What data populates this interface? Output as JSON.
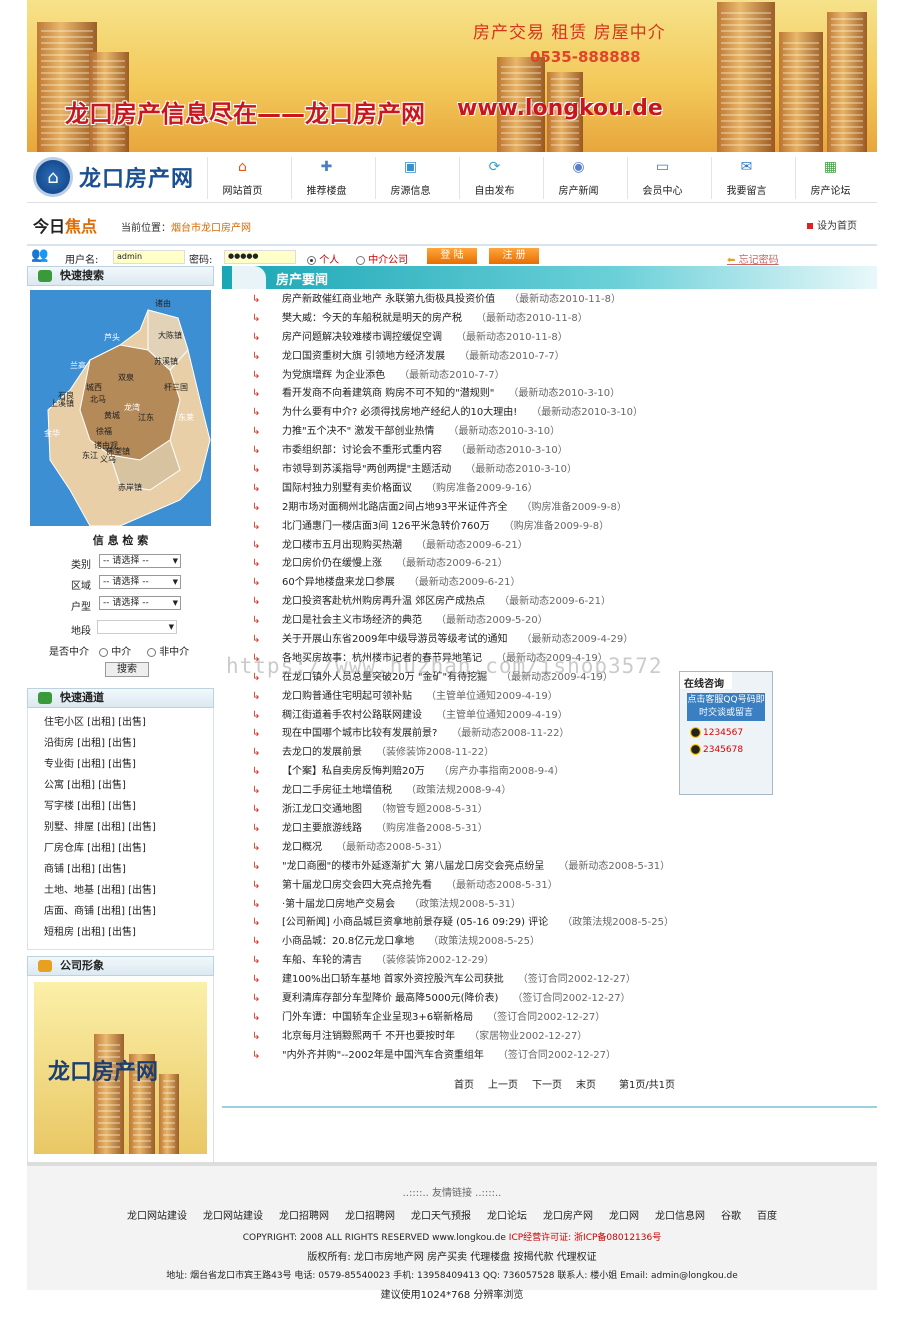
{
  "banner": {
    "tagline": "房产交易 租赁 房屋中介",
    "phone": "0535-888888",
    "slogan": "龙口房产信息尽在——龙口房产网",
    "url": "www.longkou.de"
  },
  "logo": {
    "text": "龙口房产网"
  },
  "nav": [
    {
      "label": "网站首页",
      "icon": "home-icon",
      "color": "#e8571f"
    },
    {
      "label": "推荐楼盘",
      "icon": "gamepad-icon",
      "color": "#4c7fc0"
    },
    {
      "label": "房源信息",
      "icon": "folder-icon",
      "color": "#3a8fd0"
    },
    {
      "label": "自由发布",
      "icon": "refresh-icon",
      "color": "#3aa0c8"
    },
    {
      "label": "房产新闻",
      "icon": "disc-icon",
      "color": "#5a7fc9"
    },
    {
      "label": "会员中心",
      "icon": "monitor-icon",
      "color": "#3a7fc0"
    },
    {
      "label": "我要留言",
      "icon": "chat-icon",
      "color": "#2b77c4"
    },
    {
      "label": "房产论坛",
      "icon": "picture-icon",
      "color": "#4aa04a"
    }
  ],
  "bar": {
    "today": "今日",
    "focus": "焦点",
    "location_label": "当前位置：",
    "location": "烟台市龙口房产网",
    "set_home": "设为首页"
  },
  "login": {
    "user_label": "用户名:",
    "user_value": "admin",
    "pass_label": "密码:",
    "pass_value": "●●●●●",
    "personal": "个人",
    "agency": "中介公司",
    "login_btn": "登 陆",
    "register_btn": "注 册",
    "forgot": "忘记密码"
  },
  "left": {
    "quick_search": "快速搜索",
    "map_regions": [
      "诸由",
      "大陈镇",
      "芦头",
      "苏溪镇",
      "兰高",
      "石良",
      "双泉",
      "城西",
      "杆三国",
      "上溪镇",
      "北马",
      "黄城",
      "龙湾",
      "江东",
      "东莱",
      "徐福",
      "金华",
      "诸由观",
      "东江",
      "佛堂镇",
      "赤岸镇",
      "义乌"
    ],
    "info_search": "信 息 检 索",
    "fields": [
      {
        "label": "类别",
        "value": "-- 请选择 --"
      },
      {
        "label": "区域",
        "value": "-- 请选择 --"
      },
      {
        "label": "户型",
        "value": "-- 请选择 --"
      }
    ],
    "address_label": "地段",
    "agency_label": "是否中介",
    "agency_yes": "中介",
    "agency_no": "非中介",
    "search_btn": "搜索",
    "fast_channel": "快速通道",
    "channels": [
      "住宅小区 [出租] [出售]",
      "沿街房 [出租] [出售]",
      "专业街 [出租] [出售]",
      "公寓 [出租] [出售]",
      "写字楼 [出租] [出售]",
      "别墅、排屋 [出租] [出售]",
      "厂房仓库 [出租] [出售]",
      "商铺 [出租] [出售]",
      "土地、地基 [出租] [出售]",
      "店面、商铺 [出租] [出售]",
      "短租房 [出租] [出售]"
    ],
    "company_image": "公司形象",
    "company_logo_text": "龙口房产网"
  },
  "right": {
    "title": "房产要闻",
    "news": [
      {
        "t": "房产新政催红商业地产 永联第九街极具投资价值",
        "d": "（最新动态2010-11-8）"
      },
      {
        "t": "樊大威：今天的车船税就是明天的房产税",
        "d": "（最新动态2010-11-8）"
      },
      {
        "t": "房产问题解决较难楼市调控缓促空调",
        "d": "（最新动态2010-11-8）"
      },
      {
        "t": "龙口国资重树大旗 引领地方经济发展",
        "d": "（最新动态2010-7-7）"
      },
      {
        "t": "为党旗增辉 为企业添色",
        "d": "（最新动态2010-7-7）"
      },
      {
        "t": "看开发商不向着建筑商 购房不可不知的\"潜规则\"",
        "d": "（最新动态2010-3-10）"
      },
      {
        "t": "为什么要有中介? 必须得找房地产经纪人的10大理由!",
        "d": "（最新动态2010-3-10）"
      },
      {
        "t": "力推\"五个决不\" 激发干部创业热情",
        "d": "（最新动态2010-3-10）"
      },
      {
        "t": "市委组织部：讨论会不重形式重内容",
        "d": "（最新动态2010-3-10）"
      },
      {
        "t": "市领导到苏溪指导\"两创两提\"主题活动",
        "d": "（最新动态2010-3-10）"
      },
      {
        "t": "国际村独力别墅有卖价格面议",
        "d": "（购房准备2009-9-16）"
      },
      {
        "t": "2期市场对面稠州北路店面2间占地93平米证件齐全",
        "d": "（购房准备2009-9-8）"
      },
      {
        "t": "北门通惠门一楼店面3间 126平米急转价760万",
        "d": "（购房准备2009-9-8）"
      },
      {
        "t": "龙口楼市五月出现购买热潮",
        "d": "（最新动态2009-6-21）"
      },
      {
        "t": "龙口房价仍在缓慢上涨",
        "d": "（最新动态2009-6-21）"
      },
      {
        "t": "60个异地楼盘来龙口参展",
        "d": "（最新动态2009-6-21）"
      },
      {
        "t": "龙口投资客赴杭州购房再升温 郊区房产成热点",
        "d": "（最新动态2009-6-21）"
      },
      {
        "t": "龙口是社会主义市场经济的典范",
        "d": "（最新动态2009-5-20）"
      },
      {
        "t": "关于开展山东省2009年中级导游员等级考试的通知",
        "d": "（最新动态2009-4-29）"
      },
      {
        "t": "各地买房故事：杭州楼市记者的春节异地笔记",
        "d": "（最新动态2009-4-19）"
      },
      {
        "t": "在龙口镇外人员总量突破20万 \"金矿\"有待挖掘",
        "d": "（最新动态2009-4-19）"
      },
      {
        "t": "龙口购普通住宅明起可领补贴",
        "d": "（主管单位通知2009-4-19）"
      },
      {
        "t": "稠江街道着手农村公路联网建设",
        "d": "（主管单位通知2009-4-19）"
      },
      {
        "t": "现在中国哪个城市比较有发展前景?",
        "d": "（最新动态2008-11-22）"
      },
      {
        "t": "去龙口的发展前景",
        "d": "（装修装饰2008-11-22）"
      },
      {
        "t": "【个案】私自卖房反悔判赔20万",
        "d": "（房产办事指南2008-9-4）"
      },
      {
        "t": "龙口二手房征土地增值税",
        "d": "（政策法规2008-9-4）"
      },
      {
        "t": "浙江龙口交通地图",
        "d": "（物管专题2008-5-31）"
      },
      {
        "t": "龙口主要旅游线路",
        "d": "（购房准备2008-5-31）"
      },
      {
        "t": "龙口概况",
        "d": "（最新动态2008-5-31）"
      },
      {
        "t": "\"龙口商圈\"的楼市外延逐渐扩大 第八届龙口房交会亮点纷呈",
        "d": "（最新动态2008-5-31）"
      },
      {
        "t": "第十届龙口房交会四大亮点抢先看",
        "d": "（最新动态2008-5-31）"
      },
      {
        "t": "·第十届龙口房地产交易会",
        "d": "（政策法规2008-5-31）"
      },
      {
        "t": "[公司新闻] 小商品城巨资拿地前景存疑 (05-16 09:29) 评论",
        "d": "（政策法规2008-5-25）"
      },
      {
        "t": "小商品城：20.8亿元龙口拿地",
        "d": "（政策法规2008-5-25）"
      },
      {
        "t": "车船、车轮的清吉",
        "d": "（装修装饰2002-12-29）"
      },
      {
        "t": "建100%出口轿车基地 首家外资控股汽车公司获批",
        "d": "（签订合同2002-12-27）"
      },
      {
        "t": "夏利清库存部分车型降价 最高降5000元(降价表)",
        "d": "（签订合同2002-12-27）"
      },
      {
        "t": "门外车谭：中国轿车企业呈现3+6崭新格局",
        "d": "（签订合同2002-12-27）"
      },
      {
        "t": "北京每月注销黥熙两千 不开也要按时年",
        "d": "（家居物业2002-12-27）"
      },
      {
        "t": "\"内外齐并购\"--2002年是中国汽车合资重组年",
        "d": "（签订合同2002-12-27）"
      }
    ],
    "pager": [
      "首页",
      "上一页",
      "下一页",
      "末页",
      "第1页/共1页"
    ]
  },
  "consult": {
    "title": "在线咨询",
    "banner": "点击客服QQ号码即时交谈或留言",
    "qq": [
      "1234567",
      "2345678"
    ]
  },
  "watermark": "https://www.huzhan.com/ishop3572",
  "footer": {
    "links_title": "..::::.. 友情链接 ..::::..",
    "links": [
      "龙口网站建设",
      "龙口网站建设",
      "龙口招聘网",
      "龙口招聘网",
      "龙口天气预报",
      "龙口论坛",
      "龙口房产网",
      "龙口网",
      "龙口信息网",
      "谷歌",
      "百度"
    ],
    "copyright": "COPYRIGHT: 2008 ALL RIGHTS RESERVED www.longkou.de",
    "icp": "ICP经营许可证: 浙ICP备08012136号",
    "rights": "版权所有: 龙口市房地产网 房产买卖 代理楼盘 按揭代款 代理权证",
    "address": "地址: 烟台省龙口市宾王路43号 电话: 0579-85540023 手机: 13958409413 QQ: 736057528 联系人: 楼小姐 Email: admin@longkou.de",
    "resolution": "建议使用1024*768 分辨率浏览"
  }
}
